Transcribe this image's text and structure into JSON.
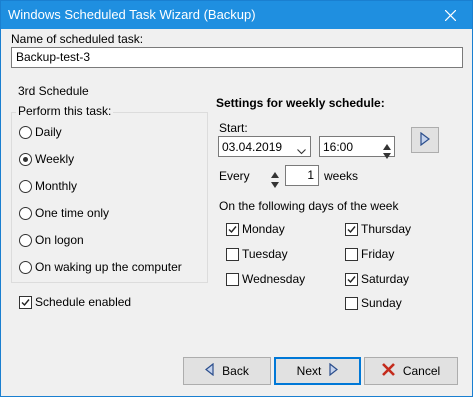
{
  "window": {
    "title": "Windows Scheduled Task Wizard (Backup)"
  },
  "task": {
    "name_label": "Name of scheduled task:",
    "name_value": "Backup-test-3"
  },
  "schedule": {
    "heading": "3rd  Schedule",
    "perform_label": "Perform this task:",
    "options": [
      "Daily",
      "Weekly",
      "Monthly",
      "One time only",
      "On logon",
      "On waking up the computer"
    ],
    "selected": "Weekly",
    "enabled_label": "Schedule enabled"
  },
  "weekly": {
    "heading": "Settings for weekly schedule:",
    "start_label": "Start:",
    "start_date": "03.04.2019",
    "start_time": "16:00",
    "every_label": "Every",
    "every_value": "1",
    "weeks_label": "weeks",
    "days_label": "On the following days of the week",
    "days": {
      "monday": "Monday",
      "tuesday": "Tuesday",
      "wednesday": "Wednesday",
      "thursday": "Thursday",
      "friday": "Friday",
      "saturday": "Saturday",
      "sunday": "Sunday"
    },
    "checked": [
      "Monday",
      "Thursday",
      "Saturday"
    ]
  },
  "buttons": {
    "back": "Back",
    "next": "Next",
    "cancel": "Cancel"
  },
  "colors": {
    "titlebar": "#1f8fe0",
    "accent": "#0078d7",
    "cancel_icon": "#c42b1c",
    "arrow_icon": "#2b4e8c"
  }
}
